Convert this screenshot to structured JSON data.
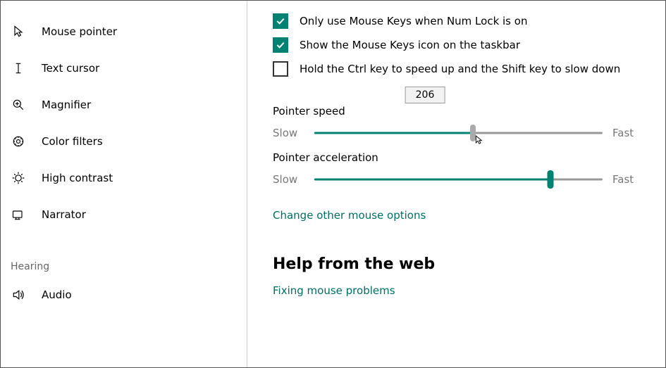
{
  "sidebar": {
    "items": [
      {
        "label": "Mouse pointer"
      },
      {
        "label": "Text cursor"
      },
      {
        "label": "Magnifier"
      },
      {
        "label": "Color filters"
      },
      {
        "label": "High contrast"
      },
      {
        "label": "Narrator"
      }
    ],
    "section_label": "Hearing",
    "hearing_items": [
      {
        "label": "Audio"
      }
    ]
  },
  "checkboxes": {
    "numlock": {
      "label": "Only use Mouse Keys when Num Lock is on",
      "checked": true
    },
    "taskbar_icon": {
      "label": "Show the Mouse Keys icon on the taskbar",
      "checked": true
    },
    "ctrl_shift": {
      "label": "Hold the Ctrl key to speed up and the Shift key to slow down",
      "checked": false
    }
  },
  "sliders": {
    "speed": {
      "label": "Pointer speed",
      "low": "Slow",
      "high": "Fast",
      "value": 206,
      "percent": 55
    },
    "accel": {
      "label": "Pointer acceleration",
      "low": "Slow",
      "high": "Fast",
      "percent": 82
    }
  },
  "links": {
    "other_options": "Change other mouse options",
    "help_link": "Fixing mouse problems"
  },
  "help_heading": "Help from the web"
}
